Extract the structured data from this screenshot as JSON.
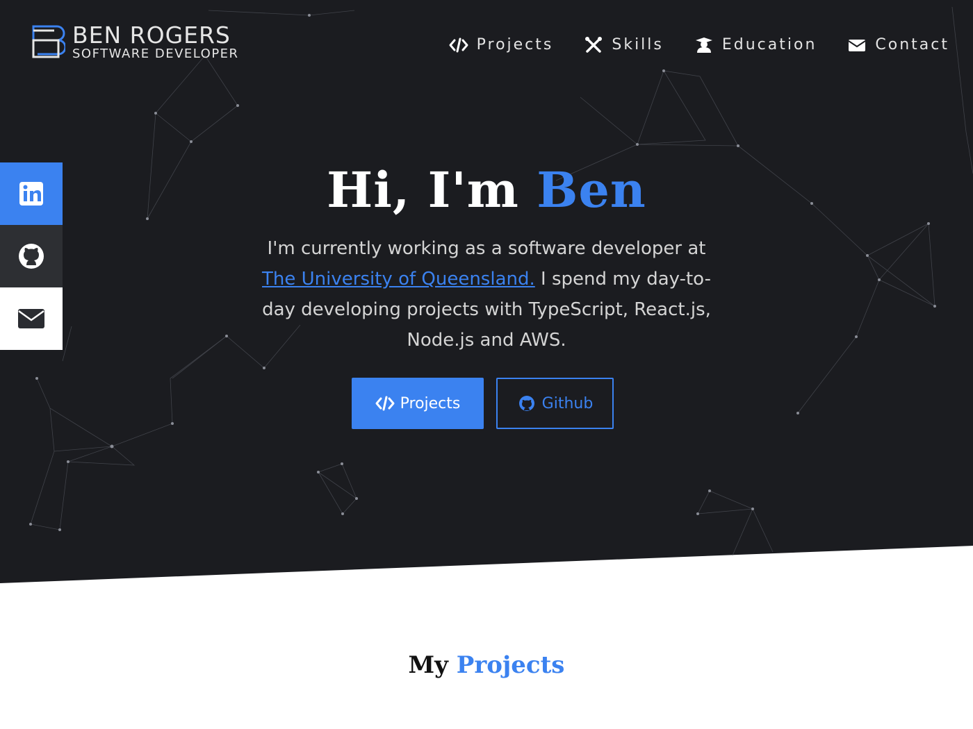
{
  "brand": {
    "name": "BEN ROGERS",
    "tagline": "SOFTWARE DEVELOPER",
    "logo_icon": "b-monogram-logo"
  },
  "nav": [
    {
      "label": "Projects",
      "icon": "code-icon"
    },
    {
      "label": "Skills",
      "icon": "tools-icon"
    },
    {
      "label": "Education",
      "icon": "graduate-icon"
    },
    {
      "label": "Contact",
      "icon": "envelope-icon"
    }
  ],
  "social": [
    {
      "name": "LinkedIn",
      "icon": "linkedin-icon"
    },
    {
      "name": "GitHub",
      "icon": "github-icon"
    },
    {
      "name": "Email",
      "icon": "envelope-icon"
    }
  ],
  "hero": {
    "greeting": "Hi, I'm",
    "name": "Ben",
    "intro_before": "I'm currently working as a software developer at",
    "intro_link": "The University of Queensland.",
    "intro_after": "I spend my day-to-day developing projects with TypeScript, React.js, Node.js and AWS.",
    "buttons": {
      "projects": "Projects",
      "github": "Github"
    }
  },
  "projects_section": {
    "title_plain": "My",
    "title_accent": "Projects"
  },
  "colors": {
    "accent": "#3b82f0",
    "hero_bg": "#1b1c20",
    "text_light": "#e4e4e4"
  }
}
